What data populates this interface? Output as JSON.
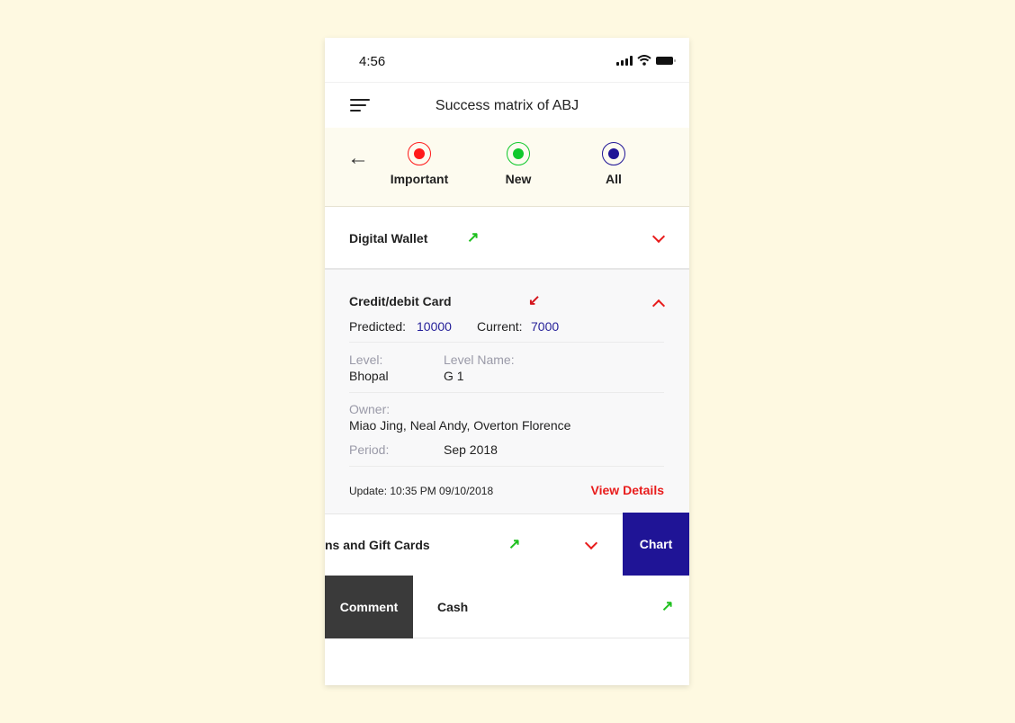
{
  "status_bar": {
    "time": "4:56"
  },
  "header": {
    "title": "Success matrix of ABJ"
  },
  "filters": [
    {
      "label": "Important",
      "color": "#ff1a1a"
    },
    {
      "label": "New",
      "color": "#10c82c"
    },
    {
      "label": "All",
      "color": "#1f1496"
    }
  ],
  "colors": {
    "accent_red": "#e81c1c",
    "trend_up": "#1fc01f",
    "trend_down": "#d4141c",
    "value_blue": "#27229a",
    "chart_button": "#1f1496",
    "comment_button": "#3a3a3a"
  },
  "items": [
    {
      "title": "Digital Wallet",
      "trend": "up",
      "trend_glyph": "↗",
      "expanded": false
    },
    {
      "title": "Credit/debit Card",
      "trend": "down",
      "trend_glyph": "↙",
      "expanded": true,
      "predicted_label": "Predicted:",
      "predicted": "10000",
      "current_label": "Current:",
      "current": "7000",
      "level_label": "Level:",
      "level": "Bhopal",
      "level_name_label": "Level Name:",
      "level_name": "G 1",
      "owner_label": "Owner:",
      "owner": "Miao Jing, Neal Andy, Overton Florence",
      "period_label": "Period:",
      "period": "Sep 2018",
      "update": "Update: 10:35 PM 09/10/2018",
      "view_details": "View Details"
    },
    {
      "title": "ns and Gift Cards",
      "trend": "up",
      "trend_glyph": "↗",
      "expanded": false,
      "swipe_action": "Chart"
    },
    {
      "title": "Cash",
      "trend": "up",
      "trend_glyph": "↗",
      "expanded": false,
      "swipe_action": "Comment"
    }
  ]
}
